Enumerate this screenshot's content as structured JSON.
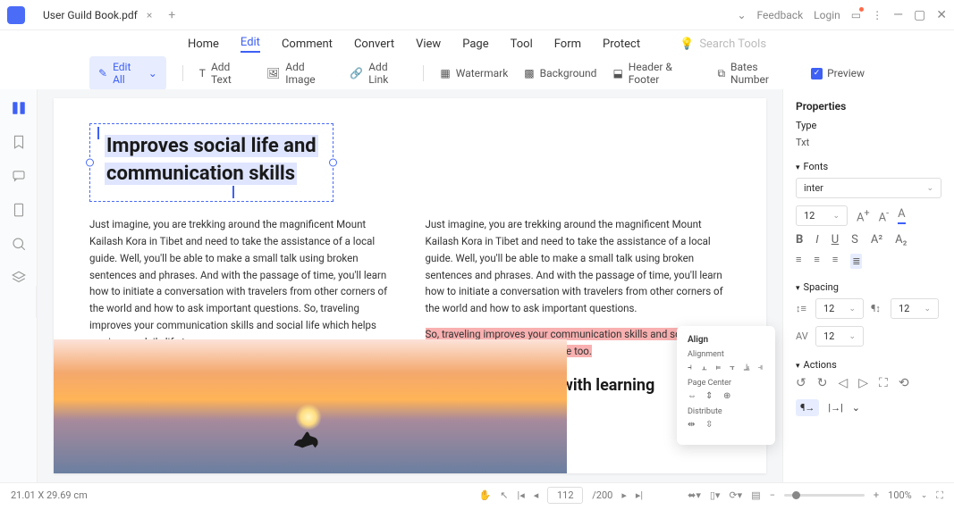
{
  "titlebar": {
    "filename": "User Guild Book.pdf",
    "feedback": "Feedback",
    "login": "Login"
  },
  "topnav": {
    "items": [
      "Home",
      "Edit",
      "Comment",
      "Convert",
      "View",
      "Page",
      "Tool",
      "Form",
      "Protect"
    ],
    "active": 1,
    "search_placeholder": "Search Tools"
  },
  "toolbar": {
    "edit_all": "Edit All",
    "add_text": "Add Text",
    "add_image": "Add Image",
    "add_link": "Add Link",
    "watermark": "Watermark",
    "background": "Background",
    "header_footer": "Header & Footer",
    "bates": "Bates Number",
    "preview": "Preview"
  },
  "doc": {
    "sel_line1": "Improves social life and",
    "sel_line2": "communication skills",
    "para": "Just imagine, you are trekking around the magnificent Mount Kailash Kora in Tibet and need to take the assistance of a local guide. Well, you'll be able to make a small talk using broken sentences and phrases. And with the passage of time, you'll learn how to initiate a conversation with travelers from other corners of the world and how to ask important questions.",
    "para_tail": " So, traveling improves your communication skills and social life which helps you in your daily life too.",
    "hl": "So, traveling improves your communication skills and social life which helps you in your daily life too.",
    "h3": "Increase your love with learning"
  },
  "popup": {
    "title": "Align",
    "s1": "Alignment",
    "s2": "Page Center",
    "s3": "Distribute"
  },
  "panel": {
    "properties": "Properties",
    "type_lbl": "Type",
    "type_val": "Txt",
    "fonts": "Fonts",
    "font_family": "inter",
    "font_size": "12",
    "spacing": "Spacing",
    "line_h": "12",
    "para_sp": "12",
    "char_sp": "12",
    "actions": "Actions"
  },
  "status": {
    "coords": "21.01 X 29.69 cm",
    "page": "112",
    "total": "/200",
    "zoom": "100%"
  }
}
